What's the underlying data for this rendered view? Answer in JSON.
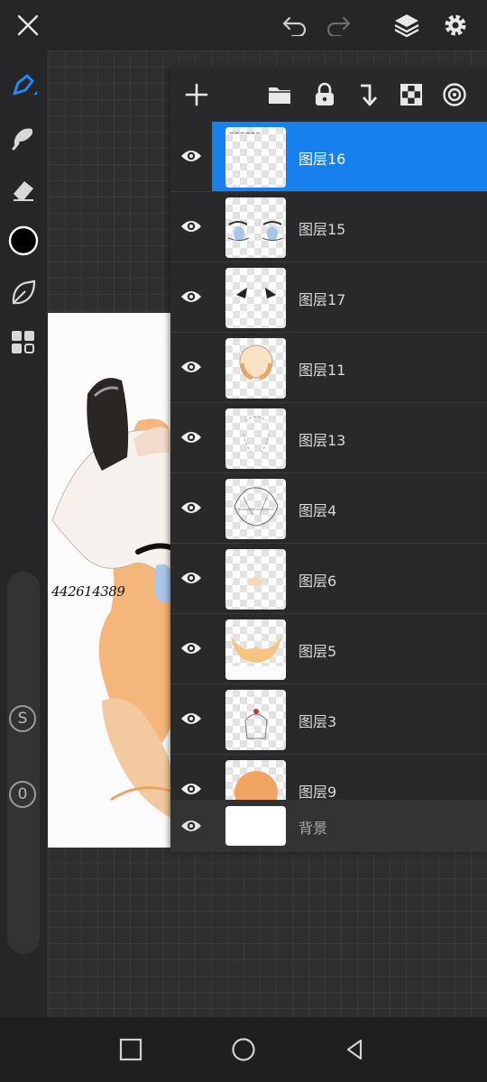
{
  "topbar": {
    "close_icon": "close-icon",
    "undo_icon": "undo-icon",
    "redo_icon": "redo-icon",
    "layers_icon": "layers-icon",
    "settings_icon": "gear-icon"
  },
  "left_toolbar": {
    "tools": [
      "brush-icon",
      "smudge-icon",
      "eraser-icon",
      "color-swatch",
      "leaf-icon",
      "grid-menu-icon"
    ],
    "color": "#000000",
    "size_slider_label": "S",
    "opacity_slider_label": "0"
  },
  "artwork": {
    "handwritten_text": "442614389"
  },
  "layers_panel": {
    "toolbar_icons": [
      "add-icon",
      "folder-icon",
      "lock-icon",
      "merge-down-icon",
      "checker-icon",
      "target-icon"
    ],
    "layers": [
      {
        "name": "图层16",
        "selected": true
      },
      {
        "name": "图层15",
        "selected": false
      },
      {
        "name": "图层17",
        "selected": false
      },
      {
        "name": "图层11",
        "selected": false
      },
      {
        "name": "图层13",
        "selected": false
      },
      {
        "name": "图层4",
        "selected": false
      },
      {
        "name": "图层6",
        "selected": false
      },
      {
        "name": "图层5",
        "selected": false
      },
      {
        "name": "图层3",
        "selected": false
      },
      {
        "name": "图层9",
        "selected": false
      }
    ],
    "background_layer": "背景",
    "accent_color": "#1680ef"
  },
  "navbar": {
    "buttons": [
      "recents-icon",
      "home-icon",
      "back-icon"
    ]
  }
}
